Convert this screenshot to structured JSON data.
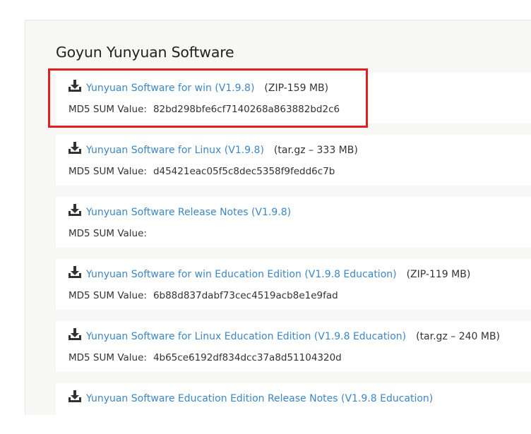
{
  "section_title": "Goyun Yunyuan Software",
  "md5_label": "MD5 SUM Value:",
  "items": [
    {
      "link": "Yunyuan Software for win (V1.9.8)",
      "size": "(ZIP-159 MB)",
      "md5": "82bd298bfe6cf7140268a863882bd2c6",
      "icon": "download-icon"
    },
    {
      "link": "Yunyuan Software for Linux (V1.9.8)",
      "size": "(tar.gz – 333 MB)",
      "md5": "d45421eac05f5c8dec5358f9fedd6c7b",
      "icon": "download-icon"
    },
    {
      "link": "Yunyuan Software Release Notes (V1.9.8)",
      "size": "",
      "md5": "",
      "icon": "download-icon"
    },
    {
      "link": "Yunyuan Software for win Education Edition (V1.9.8 Education)",
      "size": "(ZIP-119 MB)",
      "md5": "6b88d837dabf73cec4519acb8e1e9fad",
      "icon": "download-icon"
    },
    {
      "link": "Yunyuan Software for Linux Education Edition (V1.9.8 Education)",
      "size": "(tar.gz – 240 MB)",
      "md5": "4b65ce6192df834dcc37a8d51104320d",
      "icon": "download-icon"
    },
    {
      "link": "Yunyuan Software Education Edition Release Notes (V1.9.8 Education)",
      "size": "",
      "md5": "",
      "icon": "download-icon"
    }
  ],
  "colors": {
    "link": "#3d86c6",
    "highlight": "#e02020",
    "panel": "#f7f7f5"
  }
}
